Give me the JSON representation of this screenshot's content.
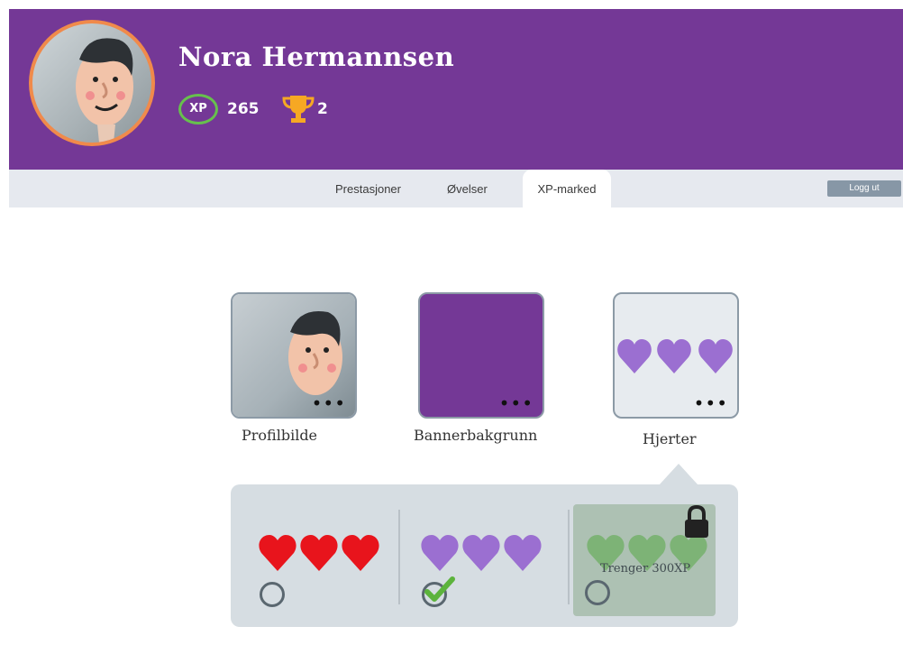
{
  "profile": {
    "name": "Nora Hermannsen",
    "xp_label": "XP",
    "xp_value": "265",
    "trophies": "2"
  },
  "nav": {
    "tabs": [
      {
        "label": "Prestasjoner"
      },
      {
        "label": "Øvelser"
      },
      {
        "label": "XP-marked"
      }
    ],
    "active_tab": "XP-marked",
    "logout_label": "Logg ut"
  },
  "market": {
    "items": [
      {
        "label": "Profilbilde",
        "more_icon": "ellipsis-icon"
      },
      {
        "label": "Bannerbakgrunn",
        "more_icon": "ellipsis-icon"
      },
      {
        "label": "Hjerter",
        "more_icon": "ellipsis-icon"
      }
    ],
    "heart_options": [
      {
        "color": "#e8141c",
        "selected": false,
        "locked": false
      },
      {
        "color": "#9b6fd1",
        "selected": true,
        "locked": false
      },
      {
        "color": "#6cbf5c",
        "selected": false,
        "locked": true,
        "lock_text": "Trenger 300XP"
      }
    ]
  },
  "colors": {
    "header": "#743896",
    "avatar_ring": "#f08a4b",
    "xp_ring": "#67c04d",
    "trophy": "#f6a823",
    "heart_purple": "#9b6fd1",
    "check_green": "#5cb33c"
  }
}
